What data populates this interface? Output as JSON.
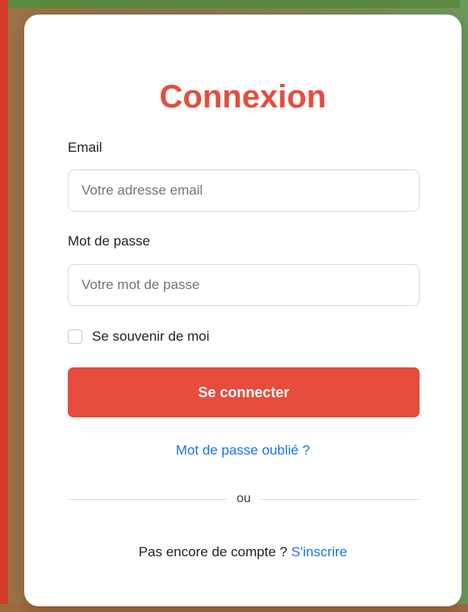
{
  "login": {
    "title": "Connexion",
    "email_label": "Email",
    "email_placeholder": "Votre adresse email",
    "email_value": "",
    "password_label": "Mot de passe",
    "password_placeholder": "Votre mot de passe",
    "password_value": "",
    "remember_label": "Se souvenir de moi",
    "remember_checked": false,
    "submit_label": "Se connecter",
    "forgot_label": "Mot de passe oublié ?",
    "divider_label": "ou",
    "signup_prompt": "Pas encore de compte ?",
    "signup_link": "S'inscrire"
  },
  "colors": {
    "accent": "#e74c3c",
    "link": "#1a73e8"
  }
}
